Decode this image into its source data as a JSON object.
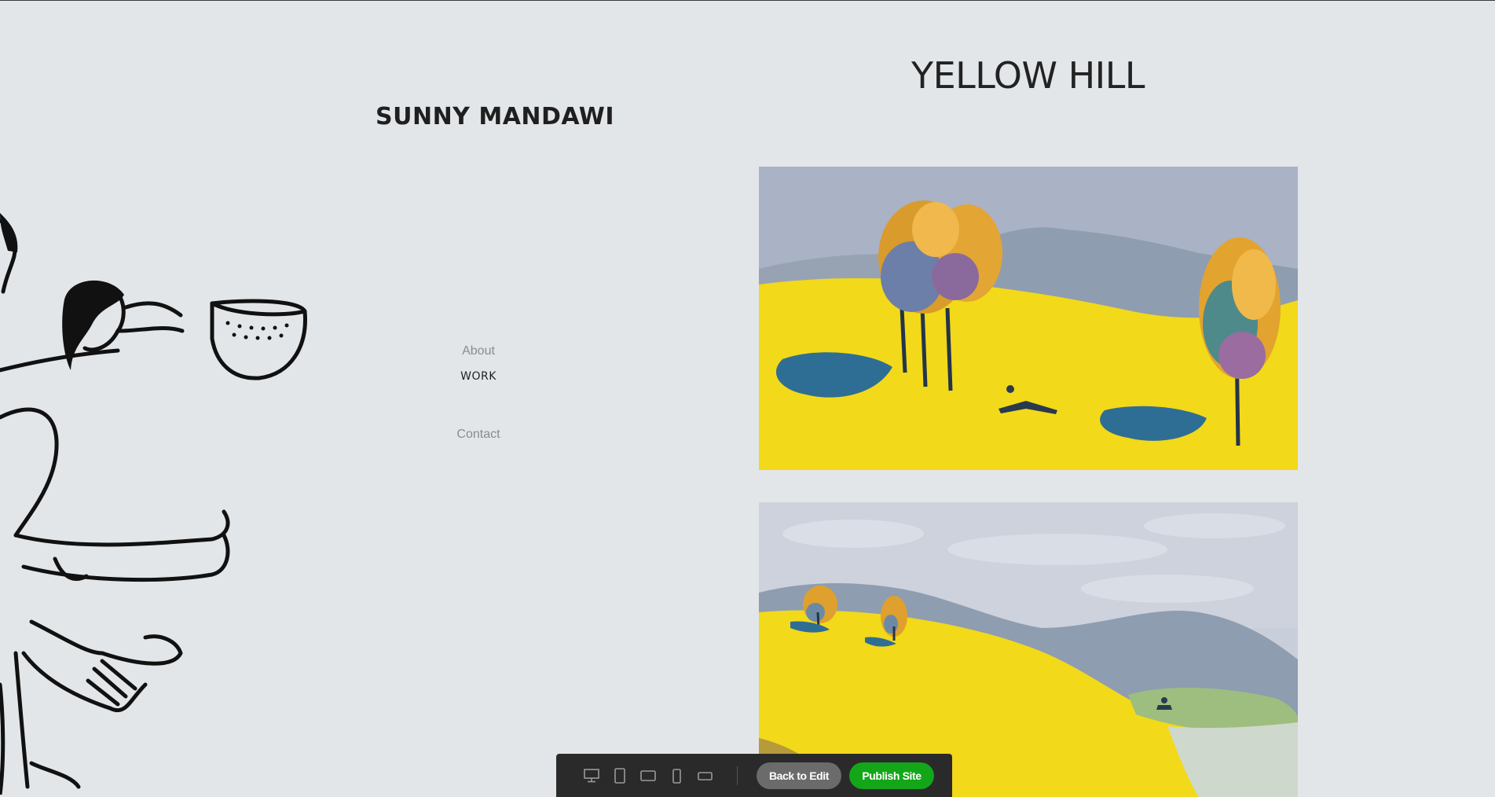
{
  "site": {
    "title": "SUNNY MANDAWI"
  },
  "nav": {
    "items": [
      {
        "label": "About"
      },
      {
        "label": "WORK"
      },
      {
        "label": "Contact"
      }
    ]
  },
  "page": {
    "heading": "YELLOW HILL"
  },
  "toolbar": {
    "devices": [
      "desktop-icon",
      "tablet-portrait-icon",
      "tablet-landscape-icon",
      "phone-portrait-icon",
      "phone-landscape-icon"
    ],
    "back_label": "Back to Edit",
    "publish_label": "Publish Site"
  },
  "colors": {
    "background": "#e3e6e9",
    "publish": "#14a619",
    "back": "#6b6b6b"
  }
}
